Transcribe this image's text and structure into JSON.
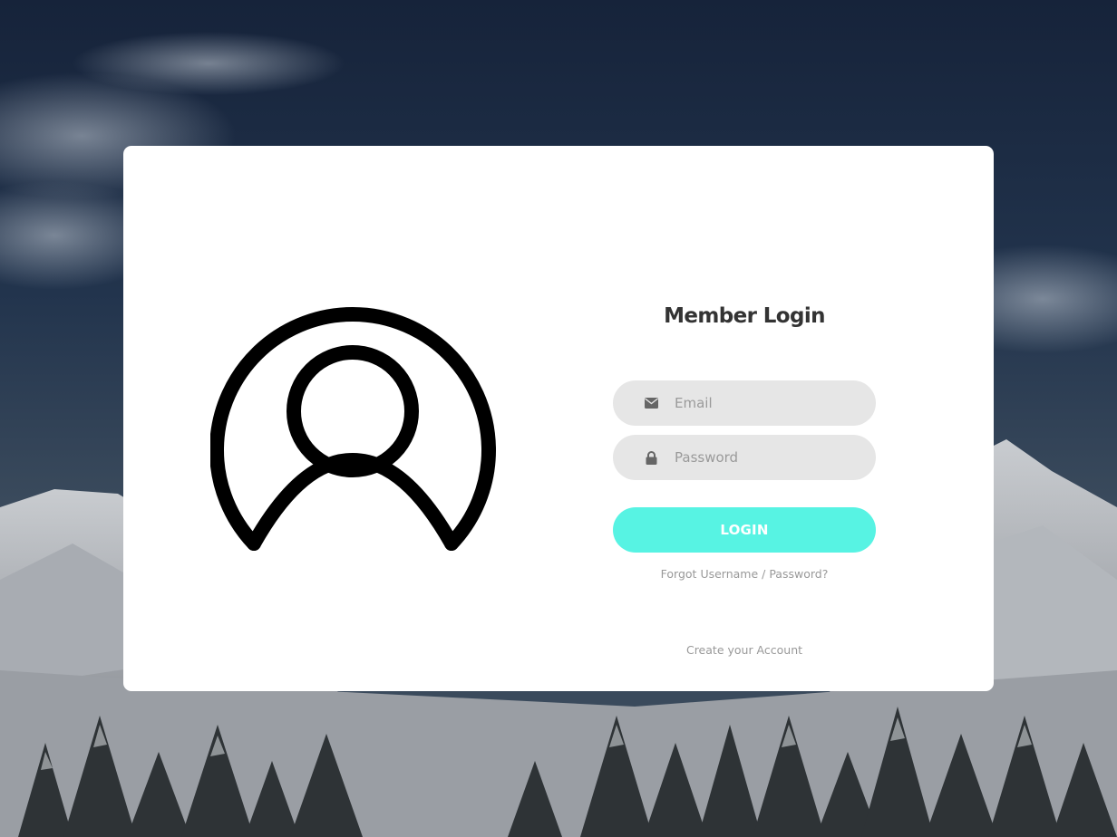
{
  "login": {
    "title": "Member Login",
    "email": {
      "placeholder": "Email",
      "value": "",
      "icon": "envelope-icon"
    },
    "password": {
      "placeholder": "Password",
      "value": "",
      "icon": "lock-icon"
    },
    "login_button": "LOGIN",
    "forgot_prefix": "Forgot",
    "forgot_link": "Username / Password?",
    "create_account": "Create your Account"
  },
  "avatar_icon": "user-circle-icon",
  "colors": {
    "accent": "#57f3e3",
    "card": "#ffffff",
    "field_bg": "#e6e6e6",
    "title": "#333333",
    "muted_text": "#999999"
  }
}
